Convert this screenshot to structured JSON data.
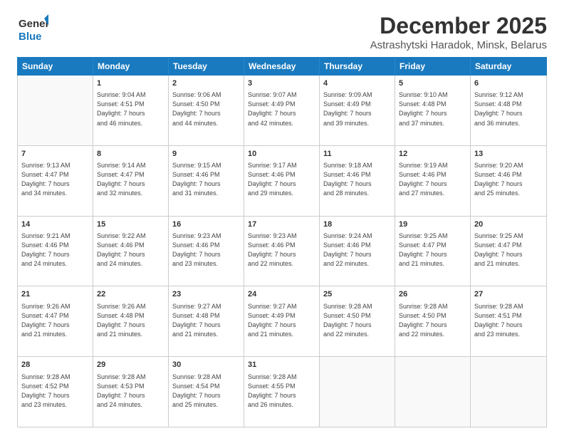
{
  "header": {
    "logo_general": "General",
    "logo_blue": "Blue",
    "title": "December 2025",
    "subtitle": "Astrashytski Haradok, Minsk, Belarus"
  },
  "weekdays": [
    "Sunday",
    "Monday",
    "Tuesday",
    "Wednesday",
    "Thursday",
    "Friday",
    "Saturday"
  ],
  "weeks": [
    [
      {
        "day": "",
        "info": ""
      },
      {
        "day": "1",
        "info": "Sunrise: 9:04 AM\nSunset: 4:51 PM\nDaylight: 7 hours\nand 46 minutes."
      },
      {
        "day": "2",
        "info": "Sunrise: 9:06 AM\nSunset: 4:50 PM\nDaylight: 7 hours\nand 44 minutes."
      },
      {
        "day": "3",
        "info": "Sunrise: 9:07 AM\nSunset: 4:49 PM\nDaylight: 7 hours\nand 42 minutes."
      },
      {
        "day": "4",
        "info": "Sunrise: 9:09 AM\nSunset: 4:49 PM\nDaylight: 7 hours\nand 39 minutes."
      },
      {
        "day": "5",
        "info": "Sunrise: 9:10 AM\nSunset: 4:48 PM\nDaylight: 7 hours\nand 37 minutes."
      },
      {
        "day": "6",
        "info": "Sunrise: 9:12 AM\nSunset: 4:48 PM\nDaylight: 7 hours\nand 36 minutes."
      }
    ],
    [
      {
        "day": "7",
        "info": "Sunrise: 9:13 AM\nSunset: 4:47 PM\nDaylight: 7 hours\nand 34 minutes."
      },
      {
        "day": "8",
        "info": "Sunrise: 9:14 AM\nSunset: 4:47 PM\nDaylight: 7 hours\nand 32 minutes."
      },
      {
        "day": "9",
        "info": "Sunrise: 9:15 AM\nSunset: 4:46 PM\nDaylight: 7 hours\nand 31 minutes."
      },
      {
        "day": "10",
        "info": "Sunrise: 9:17 AM\nSunset: 4:46 PM\nDaylight: 7 hours\nand 29 minutes."
      },
      {
        "day": "11",
        "info": "Sunrise: 9:18 AM\nSunset: 4:46 PM\nDaylight: 7 hours\nand 28 minutes."
      },
      {
        "day": "12",
        "info": "Sunrise: 9:19 AM\nSunset: 4:46 PM\nDaylight: 7 hours\nand 27 minutes."
      },
      {
        "day": "13",
        "info": "Sunrise: 9:20 AM\nSunset: 4:46 PM\nDaylight: 7 hours\nand 25 minutes."
      }
    ],
    [
      {
        "day": "14",
        "info": "Sunrise: 9:21 AM\nSunset: 4:46 PM\nDaylight: 7 hours\nand 24 minutes."
      },
      {
        "day": "15",
        "info": "Sunrise: 9:22 AM\nSunset: 4:46 PM\nDaylight: 7 hours\nand 24 minutes."
      },
      {
        "day": "16",
        "info": "Sunrise: 9:23 AM\nSunset: 4:46 PM\nDaylight: 7 hours\nand 23 minutes."
      },
      {
        "day": "17",
        "info": "Sunrise: 9:23 AM\nSunset: 4:46 PM\nDaylight: 7 hours\nand 22 minutes."
      },
      {
        "day": "18",
        "info": "Sunrise: 9:24 AM\nSunset: 4:46 PM\nDaylight: 7 hours\nand 22 minutes."
      },
      {
        "day": "19",
        "info": "Sunrise: 9:25 AM\nSunset: 4:47 PM\nDaylight: 7 hours\nand 21 minutes."
      },
      {
        "day": "20",
        "info": "Sunrise: 9:25 AM\nSunset: 4:47 PM\nDaylight: 7 hours\nand 21 minutes."
      }
    ],
    [
      {
        "day": "21",
        "info": "Sunrise: 9:26 AM\nSunset: 4:47 PM\nDaylight: 7 hours\nand 21 minutes."
      },
      {
        "day": "22",
        "info": "Sunrise: 9:26 AM\nSunset: 4:48 PM\nDaylight: 7 hours\nand 21 minutes."
      },
      {
        "day": "23",
        "info": "Sunrise: 9:27 AM\nSunset: 4:48 PM\nDaylight: 7 hours\nand 21 minutes."
      },
      {
        "day": "24",
        "info": "Sunrise: 9:27 AM\nSunset: 4:49 PM\nDaylight: 7 hours\nand 21 minutes."
      },
      {
        "day": "25",
        "info": "Sunrise: 9:28 AM\nSunset: 4:50 PM\nDaylight: 7 hours\nand 22 minutes."
      },
      {
        "day": "26",
        "info": "Sunrise: 9:28 AM\nSunset: 4:50 PM\nDaylight: 7 hours\nand 22 minutes."
      },
      {
        "day": "27",
        "info": "Sunrise: 9:28 AM\nSunset: 4:51 PM\nDaylight: 7 hours\nand 23 minutes."
      }
    ],
    [
      {
        "day": "28",
        "info": "Sunrise: 9:28 AM\nSunset: 4:52 PM\nDaylight: 7 hours\nand 23 minutes."
      },
      {
        "day": "29",
        "info": "Sunrise: 9:28 AM\nSunset: 4:53 PM\nDaylight: 7 hours\nand 24 minutes."
      },
      {
        "day": "30",
        "info": "Sunrise: 9:28 AM\nSunset: 4:54 PM\nDaylight: 7 hours\nand 25 minutes."
      },
      {
        "day": "31",
        "info": "Sunrise: 9:28 AM\nSunset: 4:55 PM\nDaylight: 7 hours\nand 26 minutes."
      },
      {
        "day": "",
        "info": ""
      },
      {
        "day": "",
        "info": ""
      },
      {
        "day": "",
        "info": ""
      }
    ]
  ],
  "colors": {
    "header_bg": "#1a7abf",
    "header_text": "#ffffff",
    "border": "#cccccc",
    "empty_bg": "#f9f9f9"
  }
}
